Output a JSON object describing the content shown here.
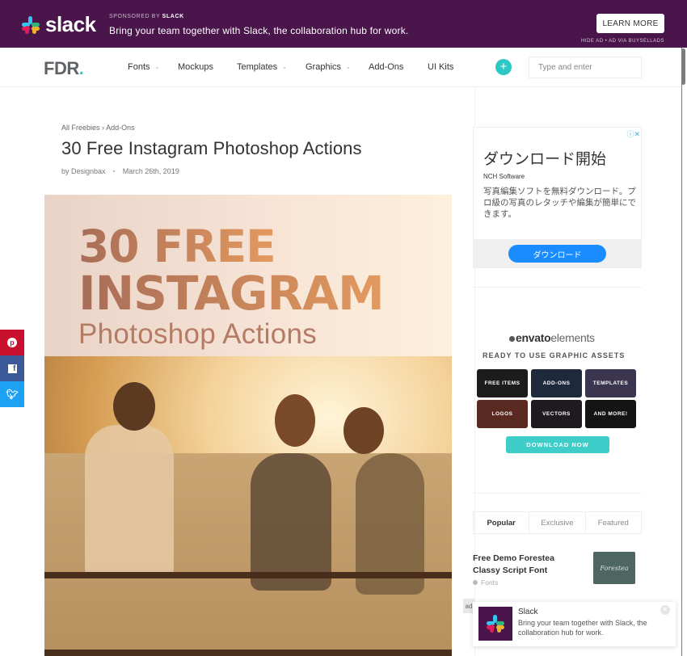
{
  "sponsor": {
    "logo_text": "slack",
    "label_prefix": "SPONSORED BY",
    "label_brand": "SLACK",
    "message": "Bring your team together with Slack, the collaboration hub for work.",
    "cta": "LEARN MORE",
    "hide_ad": "HIDE AD • AD VIA BUYSELLADS",
    "colors": {
      "background": "#4a154b"
    }
  },
  "nav": {
    "logo": "FDR",
    "logo_dot": ".",
    "items": [
      {
        "label": "Fonts",
        "has_dropdown": true
      },
      {
        "label": "Mockups",
        "has_dropdown": false
      },
      {
        "label": "Templates",
        "has_dropdown": true
      },
      {
        "label": "Graphics",
        "has_dropdown": true
      },
      {
        "label": "Add-Ons",
        "has_dropdown": false
      },
      {
        "label": "UI Kits",
        "has_dropdown": false
      }
    ],
    "plus_icon": "+",
    "search_placeholder": "Type and enter",
    "colors": {
      "accent": "#2ec8c4"
    }
  },
  "article": {
    "breadcrumb": [
      {
        "label": "All Freebies"
      },
      {
        "label": "Add-Ons"
      }
    ],
    "breadcrumb_sep": "›",
    "title": "30 Free Instagram Photoshop Actions",
    "author": "by Designbax",
    "meta_sep": "•",
    "date": "March 26th, 2019",
    "hero": {
      "line1": "30 FREE",
      "line2": "INSTAGRAM",
      "line3": "Photoshop Actions"
    }
  },
  "share": [
    {
      "network": "pinterest",
      "glyph": "℗",
      "color": "#c8102e"
    },
    {
      "network": "facebook",
      "glyph": "f",
      "color": "#3b5998"
    },
    {
      "network": "twitter",
      "glyph": "✔",
      "color": "#1da1f2"
    }
  ],
  "sidebar_ad": {
    "title": "ダウンロード開始",
    "brand": "NCH Software",
    "body": "写真編集ソフトを無料ダウンロード。プロ級の写真のレタッチや編集が簡単にできます。",
    "cta": "ダウンロード",
    "adchoices_icon": "ⓘ✕"
  },
  "envato": {
    "logo_bold": "envato",
    "logo_light": "elements",
    "tagline": "READY TO USE GRAPHIC ASSETS",
    "tiles": [
      {
        "label": "FREE ITEMS",
        "color": "#1c1c1c"
      },
      {
        "label": "ADD-ONS",
        "color": "#1e2a3b"
      },
      {
        "label": "TEMPLATES",
        "color": "#3b3550"
      },
      {
        "label": "LOGOS",
        "color": "#5a2a22"
      },
      {
        "label": "VECTORS",
        "color": "#1e1a20"
      },
      {
        "label": "AND MORE!",
        "color": "#141414"
      }
    ],
    "cta": "DOWNLOAD NOW",
    "colors": {
      "cta": "#3fcdca"
    }
  },
  "tabs": [
    {
      "label": "Popular",
      "active": true
    },
    {
      "label": "Exclusive",
      "active": false
    },
    {
      "label": "Featured",
      "active": false
    }
  ],
  "posts": [
    {
      "title": "Free Demo Forestea Classy Script Font",
      "category": "Fonts",
      "thumb_text": "Forestea"
    }
  ],
  "popup": {
    "ad_label": "ad",
    "name": "Slack",
    "body": "Bring your team together with Slack, the collaboration hub for work.",
    "close_icon": "✕"
  }
}
